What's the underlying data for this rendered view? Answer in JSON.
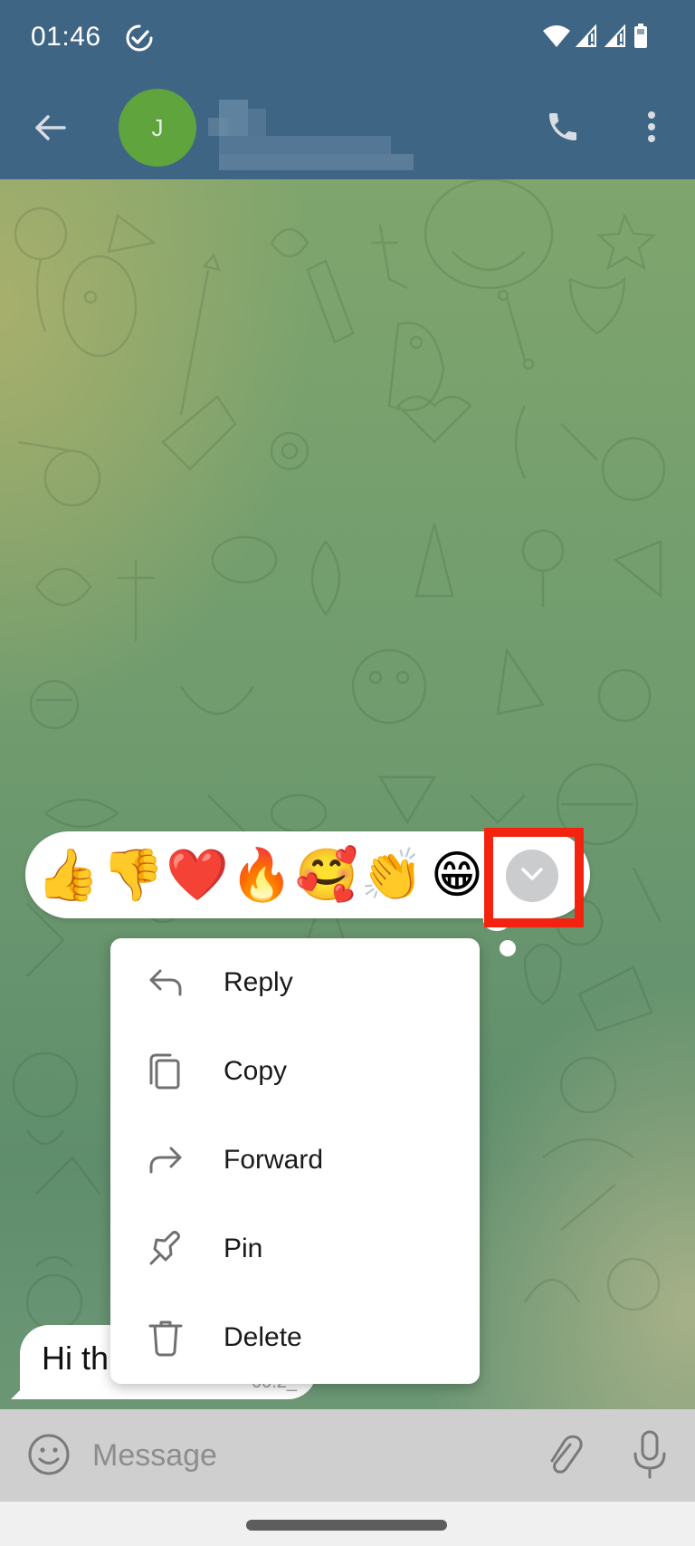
{
  "status_bar": {
    "time": "01:46",
    "icons": [
      "task-done-icon",
      "wifi-icon",
      "signal-icon",
      "signal-icon",
      "battery-icon"
    ]
  },
  "header": {
    "back_icon": "arrow-left-icon",
    "avatar_letter": "J",
    "avatar_color": "#5fa43c",
    "chat_name": "(pixelated)",
    "call_icon": "phone-icon",
    "more_icon": "more-vertical-icon",
    "header_color": "#3f6585"
  },
  "message": {
    "text": "Hi th",
    "time": "00:2_"
  },
  "reactions": {
    "emojis": [
      {
        "name": "thumbs-up",
        "glyph": "👍"
      },
      {
        "name": "thumbs-down",
        "glyph": "👎"
      },
      {
        "name": "red-heart",
        "glyph": "❤️"
      },
      {
        "name": "fire",
        "glyph": "🔥"
      },
      {
        "name": "smiling-face-with-hearts",
        "glyph": "🥰"
      },
      {
        "name": "clapping-hands",
        "glyph": "👏"
      },
      {
        "name": "beaming-face",
        "glyph": "😁"
      }
    ],
    "expand_icon": "chevron-down-icon",
    "highlight_color": "#f4230f"
  },
  "context_menu": {
    "items": [
      {
        "label": "Reply",
        "icon": "reply-icon"
      },
      {
        "label": "Copy",
        "icon": "copy-icon"
      },
      {
        "label": "Forward",
        "icon": "forward-icon"
      },
      {
        "label": "Pin",
        "icon": "pin-icon"
      },
      {
        "label": "Delete",
        "icon": "trash-icon"
      }
    ]
  },
  "input_bar": {
    "placeholder": "Message",
    "value": "",
    "emoji_icon": "smiley-icon",
    "attach_icon": "paperclip-icon",
    "mic_icon": "microphone-icon"
  }
}
